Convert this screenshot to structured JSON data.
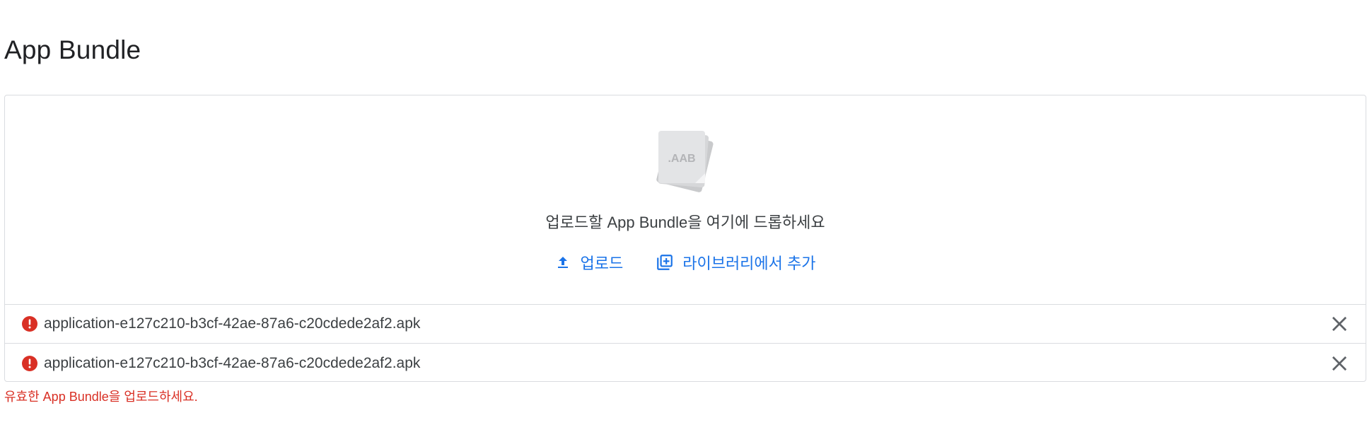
{
  "section": {
    "title": "App Bundle"
  },
  "dropzone": {
    "file_badge": ".AAB",
    "instruction": "업로드할 App Bundle을 여기에 드롭하세요",
    "upload_label": "업로드",
    "library_label": "라이브러리에서 추가",
    "icons": [
      "upload-icon",
      "library-add-icon"
    ]
  },
  "files": [
    {
      "name": "application-e127c210-b3cf-42ae-87a6-c20cdede2af2.apk",
      "status_icon": "error-icon"
    },
    {
      "name": "application-e127c210-b3cf-42ae-87a6-c20cdede2af2.apk",
      "status_icon": "error-icon"
    }
  ],
  "error_message": "유효한 App Bundle을 업로드하세요.",
  "colors": {
    "accent": "#1a73e8",
    "error": "#d93025",
    "border": "#dadce0",
    "text": "#3c4043"
  }
}
